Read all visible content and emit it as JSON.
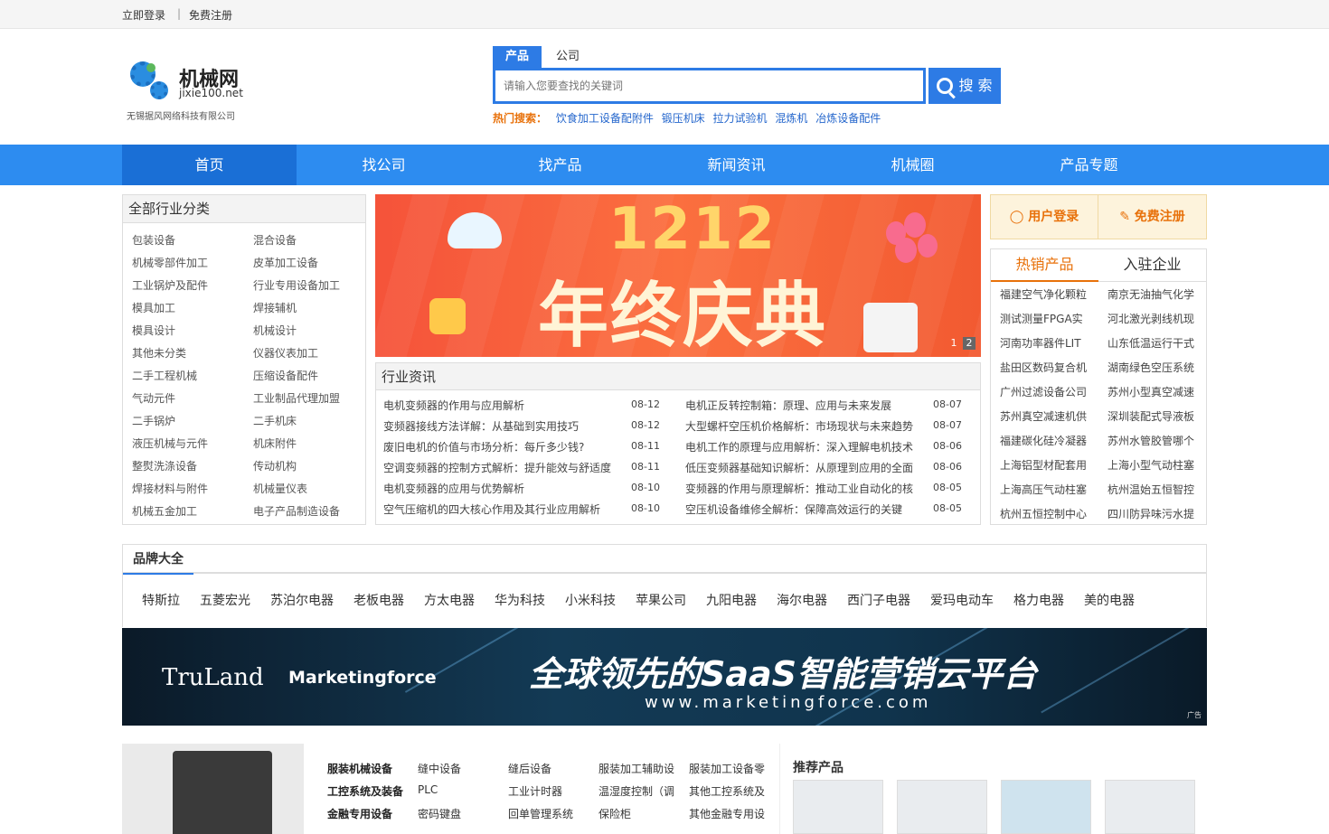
{
  "topbar": {
    "login": "立即登录",
    "sep": "|",
    "register": "免费注册"
  },
  "logo": {
    "title": "机械网",
    "domain": "jixie100.net",
    "company": "无锡据风网络科技有限公司"
  },
  "search": {
    "tabs": [
      "产品",
      "公司"
    ],
    "placeholder": "请输入您要查找的关键词",
    "button": "搜 索",
    "hot_label": "热门搜索：",
    "hot_keywords": [
      "饮食加工设备配附件",
      "锻压机床",
      "拉力试验机",
      "混炼机",
      "冶炼设备配件"
    ]
  },
  "nav": [
    "首页",
    "找公司",
    "找产品",
    "新闻资讯",
    "机械圈",
    "产品专题"
  ],
  "categories": {
    "title": "全部行业分类",
    "items": [
      "包装设备",
      "混合设备",
      "机械零部件加工",
      "皮革加工设备",
      "工业锅炉及配件",
      "行业专用设备加工",
      "模具加工",
      "焊接辅机",
      "模具设计",
      "机械设计",
      "其他未分类",
      "仪器仪表加工",
      "二手工程机械",
      "压缩设备配件",
      "气动元件",
      "工业制品代理加盟",
      "二手锅炉",
      "二手机床",
      "液压机械与元件",
      "机床附件",
      "整熨洗涤设备",
      "传动机构",
      "焊接材料与附件",
      "机械量仪表",
      "机械五金加工",
      "电子产品制造设备"
    ]
  },
  "banner": {
    "big_number": "1212",
    "title": "年终庆典",
    "pages": [
      "1",
      "2"
    ]
  },
  "news": {
    "title": "行业资讯",
    "left": [
      {
        "title": "电机变频器的作用与应用解析",
        "date": "08-12"
      },
      {
        "title": "变频器接线方法详解：从基础到实用技巧",
        "date": "08-12"
      },
      {
        "title": "废旧电机的价值与市场分析：每斤多少钱?",
        "date": "08-11"
      },
      {
        "title": "空调变频器的控制方式解析：提升能效与舒适度",
        "date": "08-11"
      },
      {
        "title": "电机变频器的应用与优势解析",
        "date": "08-10"
      },
      {
        "title": "空气压缩机的四大核心作用及其行业应用解析",
        "date": "08-10"
      }
    ],
    "right": [
      {
        "title": "电机正反转控制箱：原理、应用与未来发展",
        "date": "08-07"
      },
      {
        "title": "大型螺杆空压机价格解析：市场现状与未来趋势",
        "date": "08-07"
      },
      {
        "title": "电机工作的原理与应用解析：深入理解电机技术",
        "date": "08-06"
      },
      {
        "title": "低压变频器基础知识解析：从原理到应用的全面",
        "date": "08-06"
      },
      {
        "title": "变频器的作用与原理解析：推动工业自动化的核",
        "date": "08-05"
      },
      {
        "title": "空压机设备维修全解析：保障高效运行的关键",
        "date": "08-05"
      }
    ]
  },
  "user": {
    "login": "用户登录",
    "register": "免费注册"
  },
  "hot": {
    "tabs": [
      "热销产品",
      "入驻企业"
    ],
    "left": [
      "福建空气净化颗粒",
      "测试测量FPGA实",
      "河南功率器件LIT",
      "盐田区数码复合机",
      "广州过滤设备公司",
      "苏州真空减速机供",
      "福建碳化硅冷凝器",
      "上海铝型材配套用",
      "上海高压气动柱塞",
      "杭州五恒控制中心"
    ],
    "right": [
      "南京无油抽气化学",
      "河北激光剥线机现",
      "山东低温运行干式",
      "湖南绿色空压系统",
      "苏州小型真空减速",
      "深圳装配式导液板",
      "苏州水管胶管哪个",
      "上海小型气动柱塞",
      "杭州温始五恒智控",
      "四川防异味污水提"
    ]
  },
  "brands": {
    "title": "品牌大全",
    "items": [
      "特斯拉",
      "五菱宏光",
      "苏泊尔电器",
      "老板电器",
      "方太电器",
      "华为科技",
      "小米科技",
      "苹果公司",
      "九阳电器",
      "海尔电器",
      "西门子电器",
      "爱玛电动车",
      "格力电器",
      "美的电器"
    ]
  },
  "ad": {
    "title": "全球领先的SaaS智能营销云平台",
    "url": "www.marketingforce.com",
    "logo1": "TruLand",
    "logo2": "Marketingforce",
    "tag": "广告"
  },
  "bottom_categories": [
    {
      "title": "服装机械设备",
      "items": [
        "缝中设备",
        "缝后设备",
        "服装加工辅助设",
        "服装加工设备零"
      ]
    },
    {
      "title": "工控系统及装备",
      "items": [
        "PLC",
        "工业计时器",
        "温湿度控制（调",
        "其他工控系统及"
      ]
    },
    {
      "title": "金融专用设备",
      "items": [
        "密码键盘",
        "回单管理系统",
        "保险柜",
        "其他金融专用设"
      ]
    }
  ],
  "recommend": {
    "title": "推荐产品"
  },
  "colors": {
    "accent": "#2d7be5",
    "nav": "#2d8cf0",
    "hot": "#e8710a"
  }
}
